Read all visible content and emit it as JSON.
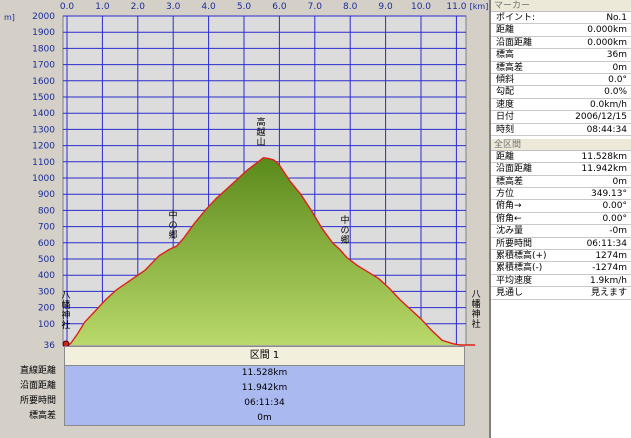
{
  "chart_data": {
    "type": "area",
    "xlabel": "[km]",
    "ylabel": "[m]",
    "x_ticks": [
      "0.0",
      "1.0",
      "2.0",
      "3.0",
      "4.0",
      "5.0",
      "6.0",
      "7.0",
      "8.0",
      "9.0",
      "10.0",
      "11.0"
    ],
    "y_ticks": [
      "2000",
      "1900",
      "1800",
      "1700",
      "1600",
      "1500",
      "1400",
      "1300",
      "1200",
      "1100",
      "1000",
      "900",
      "800",
      "700",
      "600",
      "500",
      "400",
      "300",
      "200",
      "100",
      "36"
    ],
    "xlim": [
      0,
      11.528
    ],
    "ylim": [
      36,
      2000
    ],
    "series": [
      {
        "x": [
          0,
          0.1,
          0.3,
          0.5,
          0.8,
          1.1,
          1.4,
          1.8,
          2.2,
          2.6,
          2.9,
          3.1,
          3.3,
          3.6,
          3.9,
          4.2,
          4.5,
          4.8,
          5.1,
          5.4,
          5.55,
          5.7,
          5.85,
          6.0,
          6.3,
          6.6,
          6.9,
          7.2,
          7.5,
          7.7,
          7.9,
          8.2,
          8.5,
          8.8,
          9.1,
          9.4,
          9.7,
          10.0,
          10.3,
          10.6,
          10.9,
          11.1,
          11.3,
          11.528
        ],
        "y": [
          36,
          40,
          70,
          110,
          180,
          250,
          310,
          370,
          430,
          520,
          560,
          580,
          630,
          720,
          800,
          870,
          930,
          990,
          1050,
          1100,
          1125,
          1120,
          1110,
          1080,
          980,
          900,
          800,
          690,
          600,
          560,
          510,
          460,
          420,
          380,
          320,
          250,
          190,
          130,
          80,
          50,
          40,
          36,
          36,
          36
        ]
      }
    ],
    "annotations": [
      {
        "text": "八幡神社",
        "x": 0,
        "y": 36
      },
      {
        "text": "中の郷",
        "x": 3.0,
        "y": 580
      },
      {
        "text": "高越山",
        "x": 5.6,
        "y": 1125
      },
      {
        "text": "中の郷",
        "x": 7.8,
        "y": 560
      },
      {
        "text": "八幡神社",
        "x": 11.5,
        "y": 36
      }
    ],
    "grid": true,
    "colors": {
      "fill": "#6f9a24",
      "fill_light": "#a7c94a",
      "line": "#e0201a",
      "bg": "#dcdcdc",
      "grid": "#2b2bd0"
    }
  },
  "summary": {
    "labels": [
      "直線距離",
      "沿面距離",
      "所要時間",
      "標高差"
    ],
    "section_title": "区間 1",
    "values": [
      "11.528km",
      "11.942km",
      "06:11:34",
      "0m"
    ]
  },
  "marker": {
    "head": "マーカー",
    "rows": [
      {
        "label": "ポイント:",
        "value": "No.1"
      },
      {
        "label": "距離",
        "value": "0.000km"
      },
      {
        "label": "沿面距離",
        "value": "0.000km"
      },
      {
        "label": "標高",
        "value": "36m"
      },
      {
        "label": "標高差",
        "value": "0m"
      },
      {
        "label": "傾斜",
        "value": "0.0°"
      },
      {
        "label": "勾配",
        "value": "0.0%"
      },
      {
        "label": "速度",
        "value": "0.0km/h"
      },
      {
        "label": "日付",
        "value": "2006/12/15"
      },
      {
        "label": "時刻",
        "value": "08:44:34"
      }
    ]
  },
  "whole": {
    "head": "全区間",
    "rows": [
      {
        "label": "距離",
        "value": "11.528km"
      },
      {
        "label": "沿面距離",
        "value": "11.942km"
      },
      {
        "label": "標高差",
        "value": "0m"
      },
      {
        "label": "方位",
        "value": "349.13°"
      },
      {
        "label": "俯角→",
        "value": "0.00°"
      },
      {
        "label": "俯角←",
        "value": "0.00°"
      },
      {
        "label": "沈み量",
        "value": "-0m"
      },
      {
        "label": "所要時間",
        "value": "06:11:34"
      },
      {
        "label": "累積標高(+)",
        "value": "1274m"
      },
      {
        "label": "累積標高(-)",
        "value": "-1274m"
      },
      {
        "label": "平均速度",
        "value": "1.9km/h"
      },
      {
        "label": "見通し",
        "value": "見えます"
      }
    ]
  }
}
